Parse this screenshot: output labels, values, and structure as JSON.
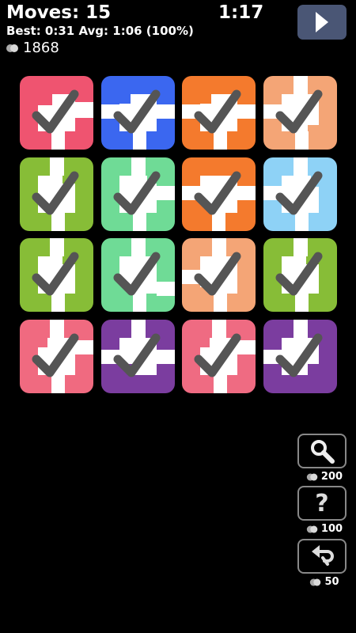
{
  "header": {
    "moves": "Moves: 15",
    "timer": "1:17",
    "stats": "Best: 0:31 Avg: 1:06 (100%)",
    "coins": "1868"
  },
  "tiles": [
    {
      "color": "#ef5470",
      "pattern": "a"
    },
    {
      "color": "#3b67f0",
      "pattern": "b"
    },
    {
      "color": "#f47a2d",
      "pattern": "b"
    },
    {
      "color": "#f4a576",
      "pattern": "c"
    },
    {
      "color": "#87bd37",
      "pattern": "d"
    },
    {
      "color": "#6fdb96",
      "pattern": "e"
    },
    {
      "color": "#f47a2d",
      "pattern": "f"
    },
    {
      "color": "#8ed2f6",
      "pattern": "g"
    },
    {
      "color": "#87bd37",
      "pattern": "d"
    },
    {
      "color": "#6fdb96",
      "pattern": "h"
    },
    {
      "color": "#f4a576",
      "pattern": "i"
    },
    {
      "color": "#87bd37",
      "pattern": "d"
    },
    {
      "color": "#f06a80",
      "pattern": "j"
    },
    {
      "color": "#7b3d9f",
      "pattern": "k"
    },
    {
      "color": "#ef6b82",
      "pattern": "j"
    },
    {
      "color": "#7b3d9f",
      "pattern": "l"
    }
  ],
  "powerups": [
    {
      "name": "reveal",
      "icon": "magnifier-icon",
      "cost": "200"
    },
    {
      "name": "hint",
      "icon": "question-icon",
      "cost": "100"
    },
    {
      "name": "undo",
      "icon": "undo-icon",
      "cost": "50"
    }
  ]
}
